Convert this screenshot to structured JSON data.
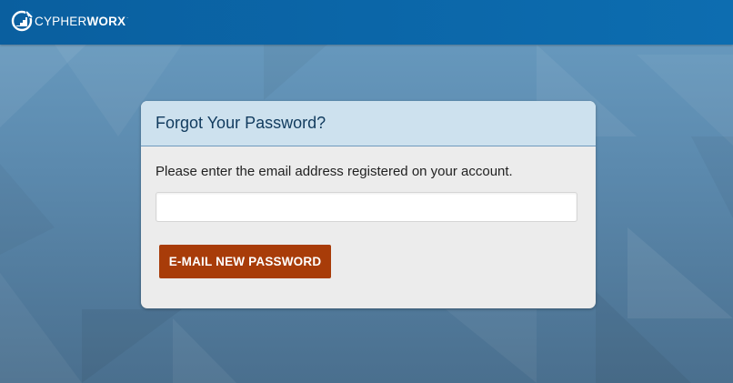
{
  "header": {
    "logo": {
      "icon": "cypherworx-logo-icon",
      "name_light": "CYPHER",
      "name_bold": "WORX",
      "trademark": "."
    }
  },
  "form": {
    "title": "Forgot Your Password?",
    "prompt": "Please enter the email address registered on your account.",
    "email_value": "",
    "email_placeholder": "",
    "submit_label": "E-MAIL NEW PASSWORD"
  },
  "colors": {
    "topbar": "#0b66a8",
    "card_header": "#cde1ee",
    "button": "#a83c09",
    "title_text": "#113b5e"
  }
}
